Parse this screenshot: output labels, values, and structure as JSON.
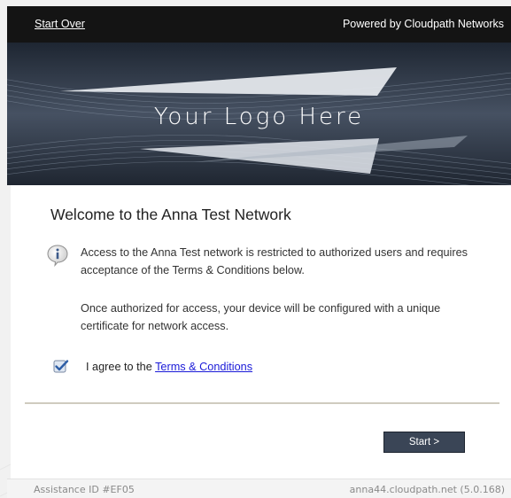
{
  "topbar": {
    "start_over": "Start Over",
    "powered_by": "Powered by Cloudpath Networks"
  },
  "banner": {
    "logo_text": "Your Logo Here"
  },
  "main": {
    "heading": "Welcome to the Anna Test Network",
    "info_icon": "info-icon",
    "paragraph1": "Access to the Anna Test network is restricted to authorized users and requires acceptance of the Terms & Conditions below.",
    "paragraph2": "Once authorized for access, your device will be configured with a unique certificate for network access.",
    "agree_prefix": "I agree to the ",
    "terms_link": "Terms & Conditions",
    "agree_checked": true,
    "start_button": "Start >"
  },
  "footer": {
    "assistance_id": "Assistance ID #EF05",
    "host": "anna44.cloudpath.net (5.0.168)"
  },
  "colors": {
    "topbar_bg": "#141414",
    "banner_bg": "#3d4757",
    "button_bg": "#3a4556",
    "link": "#1a1ad8"
  }
}
